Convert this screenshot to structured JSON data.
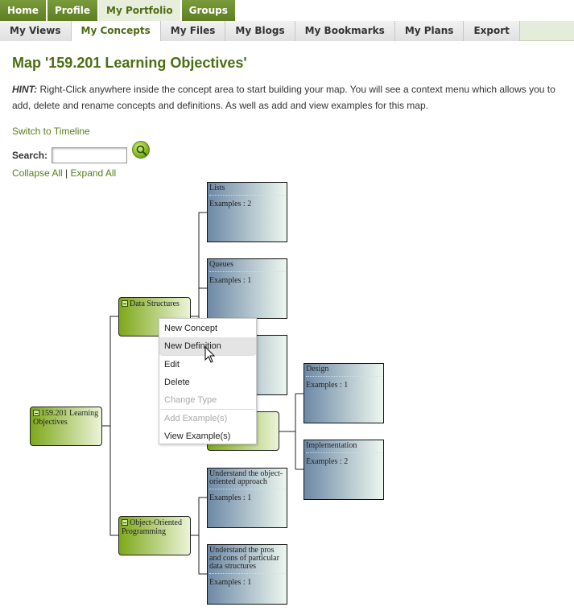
{
  "top_tabs": [
    "Home",
    "Profile",
    "My Portfolio",
    "Groups"
  ],
  "sub_tabs": [
    "My Views",
    "My Concepts",
    "My Files",
    "My Blogs",
    "My Bookmarks",
    "My Plans",
    "Export"
  ],
  "page_title": "Map '159.201 Learning Objectives'",
  "hint": {
    "label": "HINT:",
    "text": " Right-Click anywhere inside the concept area to start building your map. You will see a context menu which allows you to add, delete and rename concepts and definitions. As well as add and view examples for this map."
  },
  "switch_link": "Switch to Timeline",
  "search": {
    "label": "Search:",
    "value": "",
    "placeholder": ""
  },
  "collapse_all": "Collapse All",
  "separator": "|",
  "expand_all": "Expand All",
  "concepts": {
    "root": "159.201 Learning Objectives",
    "data_structures": "Data Structures",
    "oop": "Object-Oriented Programming"
  },
  "definitions": {
    "lists": {
      "title": "Lists",
      "examples": "Examples : 2"
    },
    "queues": {
      "title": "Queues",
      "examples": "Examples : 1"
    },
    "design": {
      "title": "Design",
      "examples": "Examples : 1"
    },
    "implementation": {
      "title": "Implementation",
      "examples": "Examples : 2"
    },
    "understand_oo": {
      "title": "Understand the object-oriented approach",
      "examples": "Examples : 1"
    },
    "understand_pros": {
      "title": "Understand the pros and cons of particular data structures",
      "examples": "Examples : 1"
    }
  },
  "context_menu": {
    "items": [
      "New Concept",
      "New Definition",
      "Edit",
      "Delete",
      "Change Type",
      "Add Example(s)",
      "View Example(s)"
    ],
    "hovered": "New Definition",
    "disabled": [
      "Change Type",
      "Add Example(s)"
    ]
  },
  "icons": {
    "search": "search-icon",
    "cursor": "mouse-pointer-icon",
    "collapse": "minus-box-icon"
  },
  "colors": {
    "accent": "#5a7d1a",
    "tab_green": "#6a8c2c",
    "node_green": "#7ea81a",
    "def_blue": "#6d89a6"
  }
}
